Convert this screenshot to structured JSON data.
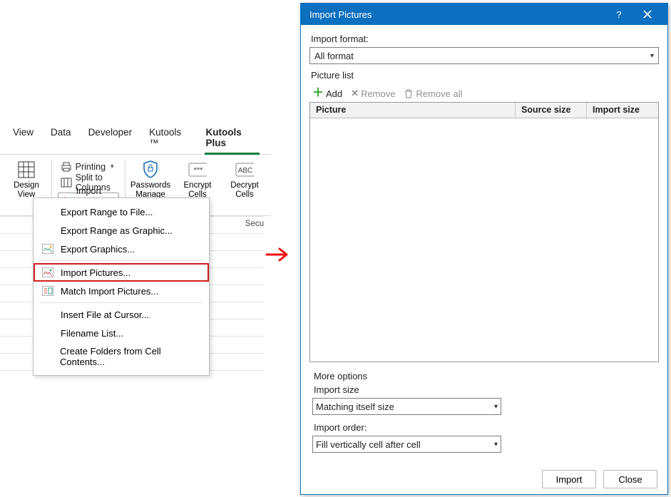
{
  "ribbon": {
    "tabs": {
      "view": "View",
      "data": "Data",
      "developer": "Developer",
      "kutools": "Kutools ™",
      "kutools_plus": "Kutools Plus"
    },
    "design_view": "Design\nView",
    "printing": "Printing",
    "split_cols": "Split to Columns",
    "import_export": "Import & Export",
    "passwords_manage": "Passwords\nManage",
    "encrypt": "Encrypt\nCells",
    "decrypt": "Decrypt\nCells",
    "secu_group": "Secu"
  },
  "menu": {
    "export_range_file": "Export Range to File...",
    "export_range_graphic": "Export Range as Graphic...",
    "export_graphics": "Export Graphics...",
    "import_pictures": "Import Pictures...",
    "match_import_pictures": "Match Import Pictures...",
    "insert_file_cursor": "Insert File at Cursor...",
    "filename_list": "Filename List...",
    "create_folders": "Create Folders from Cell Contents..."
  },
  "dialog": {
    "title": "Import Pictures",
    "import_format_lbl": "Import format:",
    "import_format_val": "All format",
    "picture_list_lbl": "Picture list",
    "add": "Add",
    "remove": "Remove",
    "remove_all": "Remove all",
    "col_picture": "Picture",
    "col_source": "Source size",
    "col_import": "Import size",
    "more_options": "More options",
    "import_size_lbl": "Import size",
    "import_size_val": "Matching itself size",
    "import_order_lbl": "Import order:",
    "import_order_val": "Fill vertically cell after cell",
    "import_btn": "Import",
    "close_btn": "Close"
  }
}
